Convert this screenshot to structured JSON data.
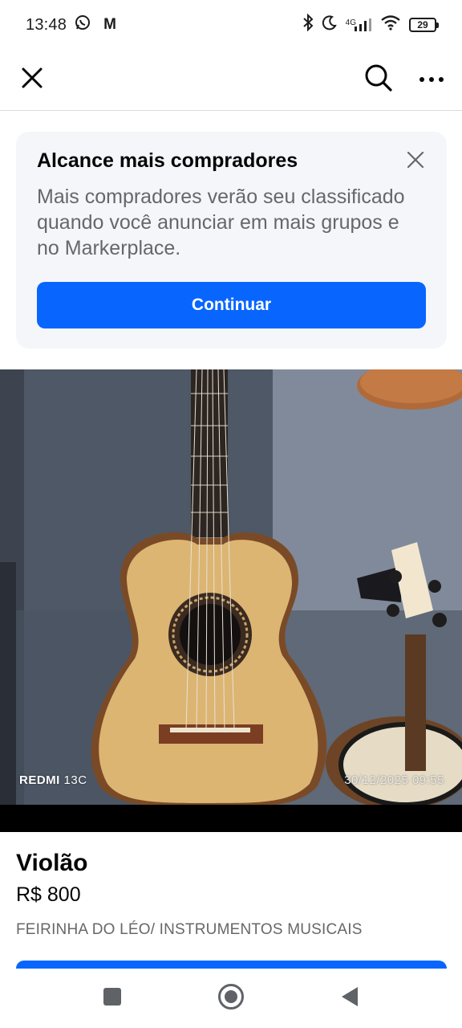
{
  "status_bar": {
    "time": "13:48",
    "carrier_letter": "M",
    "network": "4G",
    "battery": "29"
  },
  "header": {
    "close_icon": "close-icon",
    "search_icon": "search-icon",
    "more_icon": "more-icon"
  },
  "promo": {
    "title": "Alcance mais compradores",
    "body": "Mais compradores verão seu classificado quando você anunciar em mais grupos e no Markerplace.",
    "button_label": "Continuar"
  },
  "photo": {
    "watermark_brand": "REDMI",
    "watermark_model": "13C",
    "watermark_datetime": "30/12/2025 09:55"
  },
  "listing": {
    "title": "Violão",
    "price": "R$ 800",
    "category": "FEIRINHA DO LÉO/ INSTRUMENTOS MUSICAIS"
  },
  "colors": {
    "accent": "#0866ff",
    "secondary_text": "#65676b",
    "card_bg": "#f4f6f9"
  }
}
